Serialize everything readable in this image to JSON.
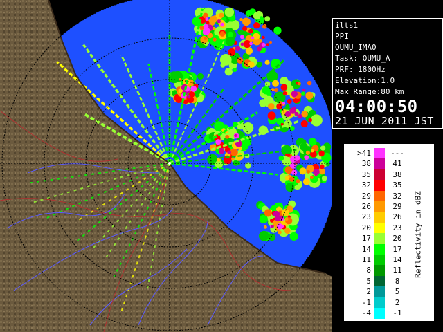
{
  "info": {
    "site": "ilts1",
    "product": "PPI",
    "scan": "OUMU_IMA0",
    "task": "Task: OUMU_A",
    "prf": "PRF: 1800Hz",
    "elevation": "Elevation:1.0",
    "max_range": "Max Range:80 km",
    "time": "04:00:50",
    "date": "21 JUN 2011 JST"
  },
  "legend": {
    "title": "Reflectivity in dBZ",
    "rows": [
      {
        "lo": ">41",
        "hi": "---",
        "color": "#ff33ff"
      },
      {
        "lo": "38",
        "hi": "41",
        "color": "#cc0099"
      },
      {
        "lo": "35",
        "hi": "38",
        "color": "#cc0033"
      },
      {
        "lo": "32",
        "hi": "35",
        "color": "#ff0000"
      },
      {
        "lo": "29",
        "hi": "32",
        "color": "#ff6600"
      },
      {
        "lo": "26",
        "hi": "29",
        "color": "#ff9900"
      },
      {
        "lo": "23",
        "hi": "26",
        "color": "#ffcc00"
      },
      {
        "lo": "20",
        "hi": "23",
        "color": "#ffff00"
      },
      {
        "lo": "17",
        "hi": "20",
        "color": "#99ff33"
      },
      {
        "lo": "14",
        "hi": "17",
        "color": "#00ff00"
      },
      {
        "lo": "11",
        "hi": "14",
        "color": "#00cc00"
      },
      {
        "lo": "8",
        "hi": "11",
        "color": "#009900"
      },
      {
        "lo": "5",
        "hi": "8",
        "color": "#006633"
      },
      {
        "lo": "2",
        "hi": "5",
        "color": "#009999"
      },
      {
        "lo": "-1",
        "hi": "2",
        "color": "#00cccc"
      },
      {
        "lo": "-4",
        "hi": "-1",
        "color": "#00ffff"
      }
    ]
  },
  "colors": {
    "background": "#000000",
    "sea_echo": "#1e50ff",
    "terrain": "#6b5a3e"
  }
}
